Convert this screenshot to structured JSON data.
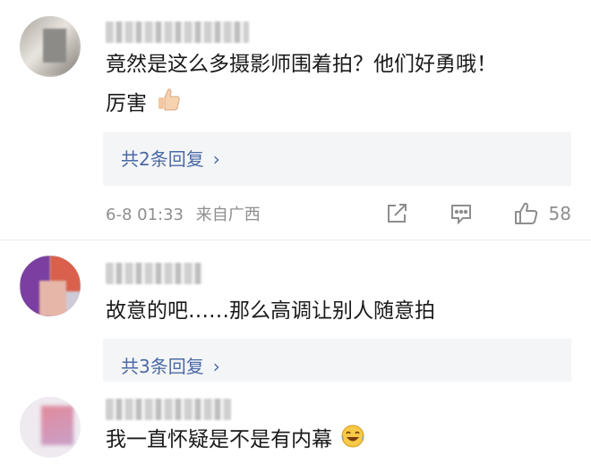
{
  "comments": [
    {
      "text_line1": "竟然是这么多摄影师围着拍？他们好勇哦！",
      "text_line2": "厉害",
      "replies_label": "共2条回复",
      "timestamp": "6-8 01:33",
      "location": "来自广西",
      "like_count": "58"
    },
    {
      "text_line1": "故意的吧……那么高调让别人随意拍",
      "replies_label": "共3条回复"
    },
    {
      "text_line1": "我一直怀疑是不是有内幕"
    }
  ],
  "icons": {
    "chevron": "›",
    "share": "share-icon",
    "comment": "comment-icon",
    "like": "thumbs-up-icon",
    "thumbs_emoji": "thumbs-up-emoji",
    "laugh_emoji": "laughing-tears-emoji"
  }
}
